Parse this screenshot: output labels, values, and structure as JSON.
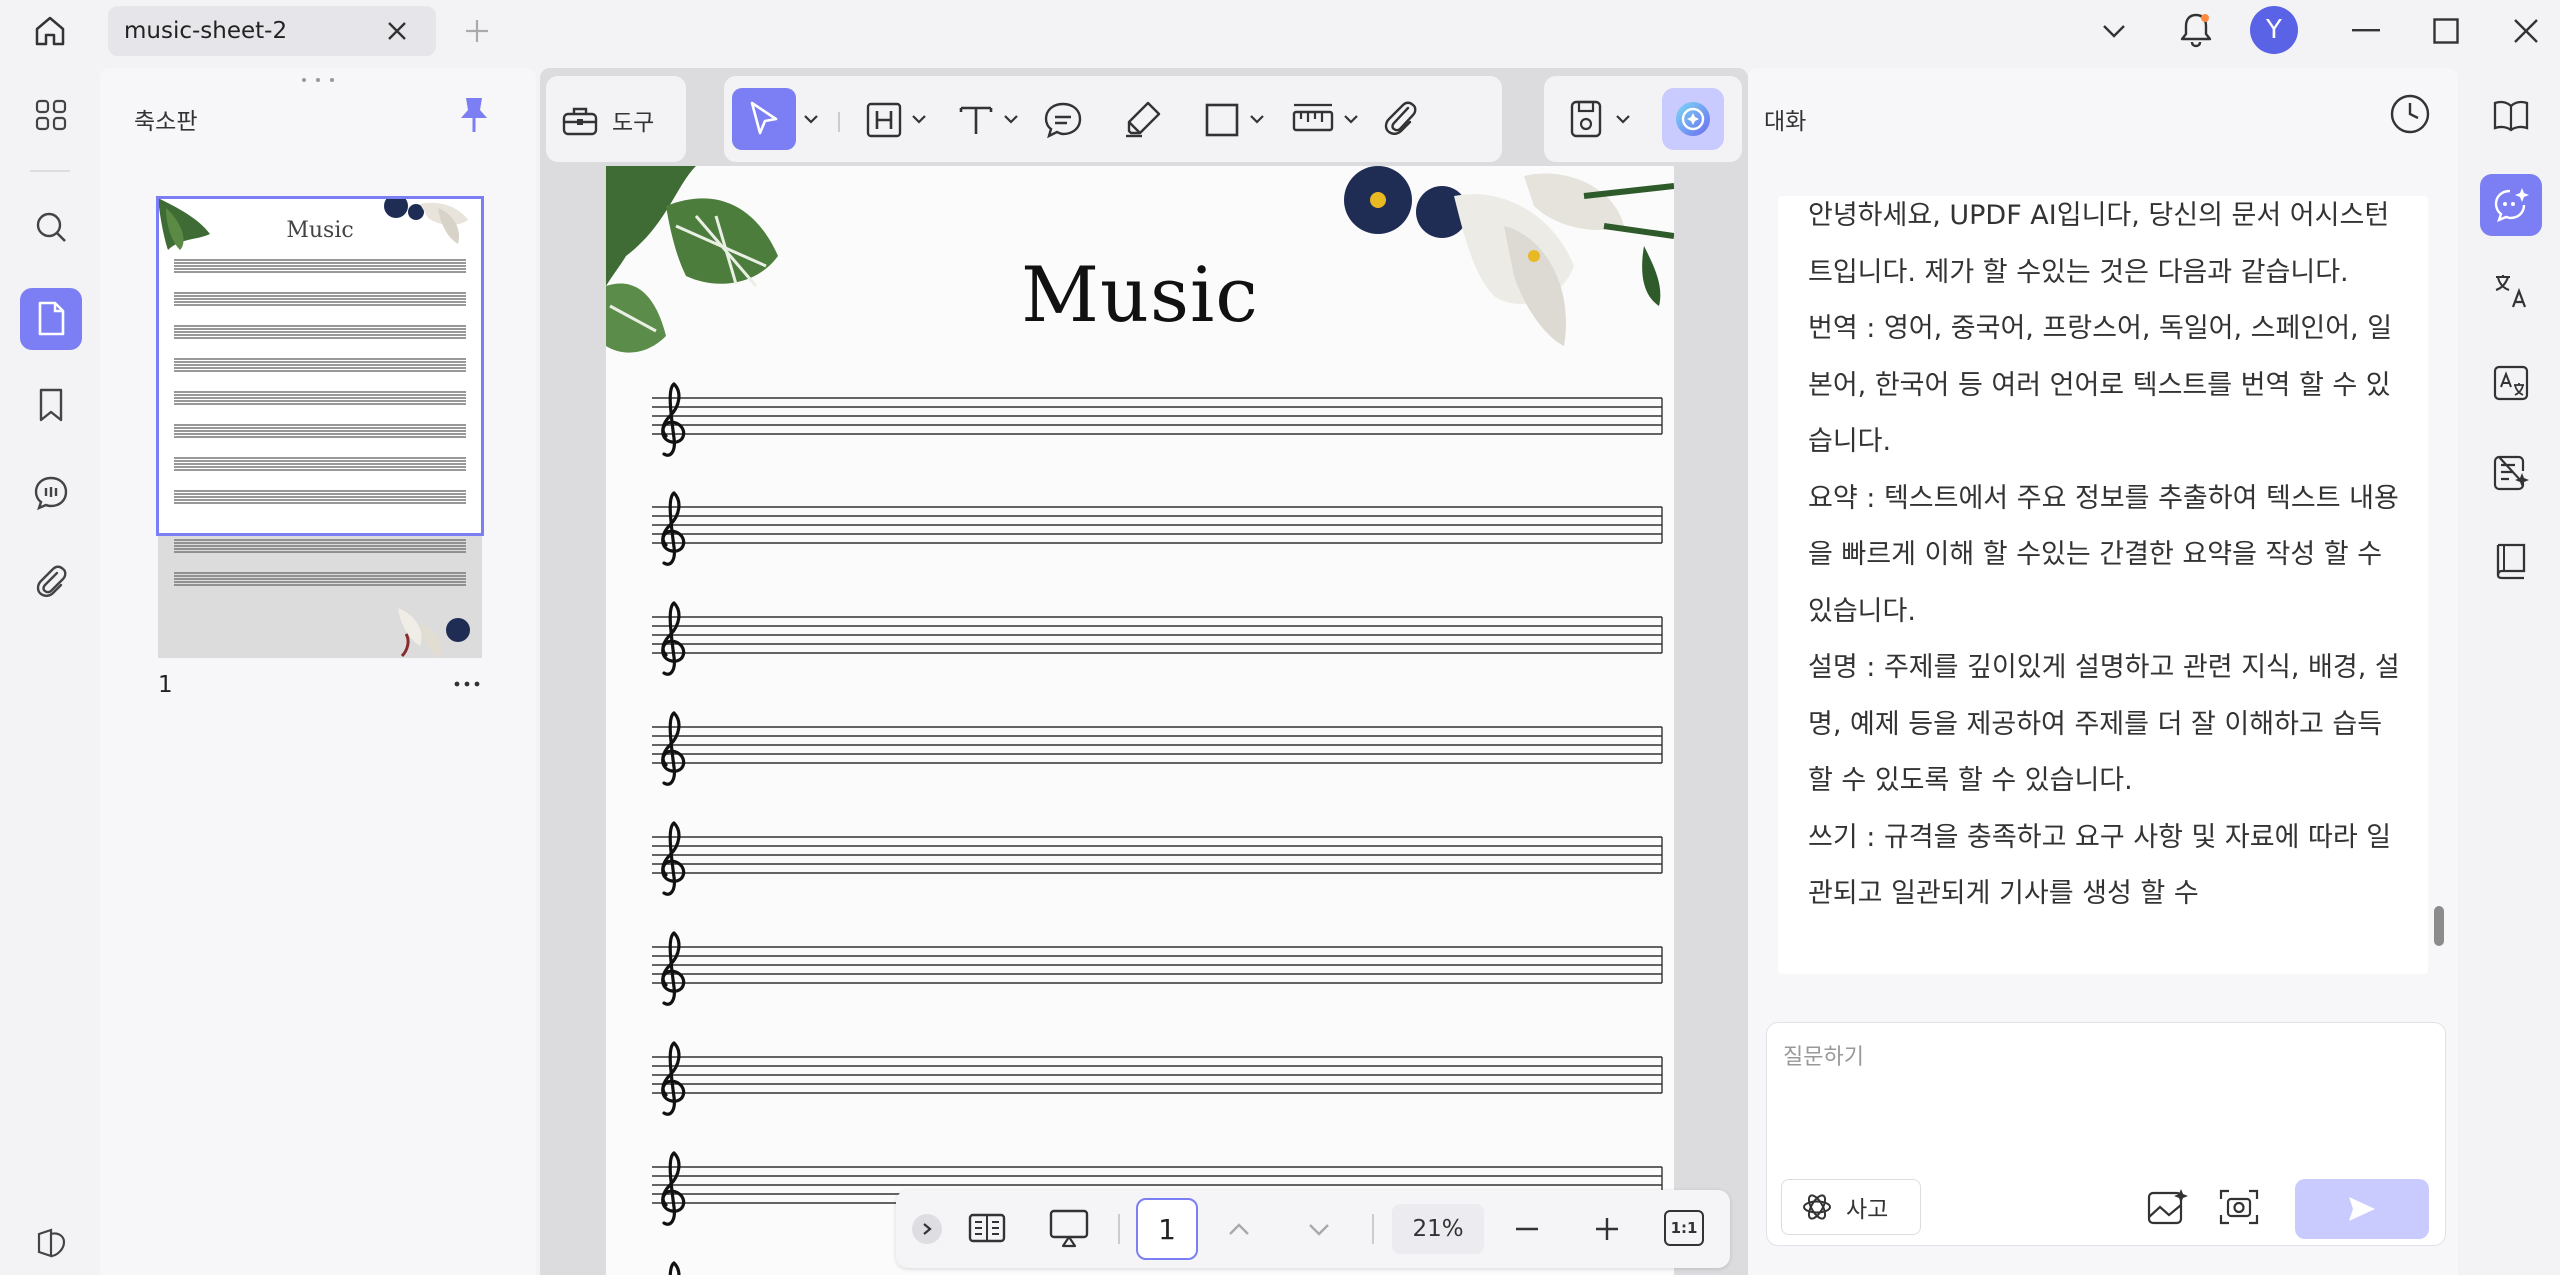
{
  "tab": {
    "title": "music-sheet-2"
  },
  "user": {
    "initial": "Y"
  },
  "thumbnail_panel": {
    "title": "축소판",
    "page_label": "1",
    "thumb_title": "Music"
  },
  "toolbar": {
    "tools_label": "도구"
  },
  "document": {
    "title": "Music"
  },
  "bottom_bar": {
    "page_number": "1",
    "zoom": "21%",
    "fit_label": "1:1"
  },
  "chat": {
    "title": "대화",
    "paragraphs": [
      "안녕하세요, UPDF AI입니다, 당신의 문서 어시스턴트입니다. 제가 할 수있는 것은 다음과 같습니다.",
      "번역 : 영어, 중국어, 프랑스어, 독일어, 스페인어, 일본어, 한국어 등 여러 언어로 텍스트를 번역 할 수 있습니다.",
      "요약 : 텍스트에서 주요 정보를 추출하여 텍스트 내용을 빠르게 이해 할 수있는 간결한 요약을 작성 할 수 있습니다.",
      "설명 : 주제를 깊이있게 설명하고 관련 지식, 배경, 설명, 예제 등을 제공하여 주제를 더 잘 이해하고 습득 할 수 있도록 할 수 있습니다.",
      "쓰기 : 규격을 충족하고 요구 사항 및 자료에 따라 일관되고 일관되게 기사를 생성 할 수"
    ],
    "input_placeholder": "질문하기",
    "think_label": "사고"
  },
  "colors": {
    "accent": "#7b7ff3",
    "accent_light": "#c9cbff",
    "avatar": "#5a63e6"
  }
}
